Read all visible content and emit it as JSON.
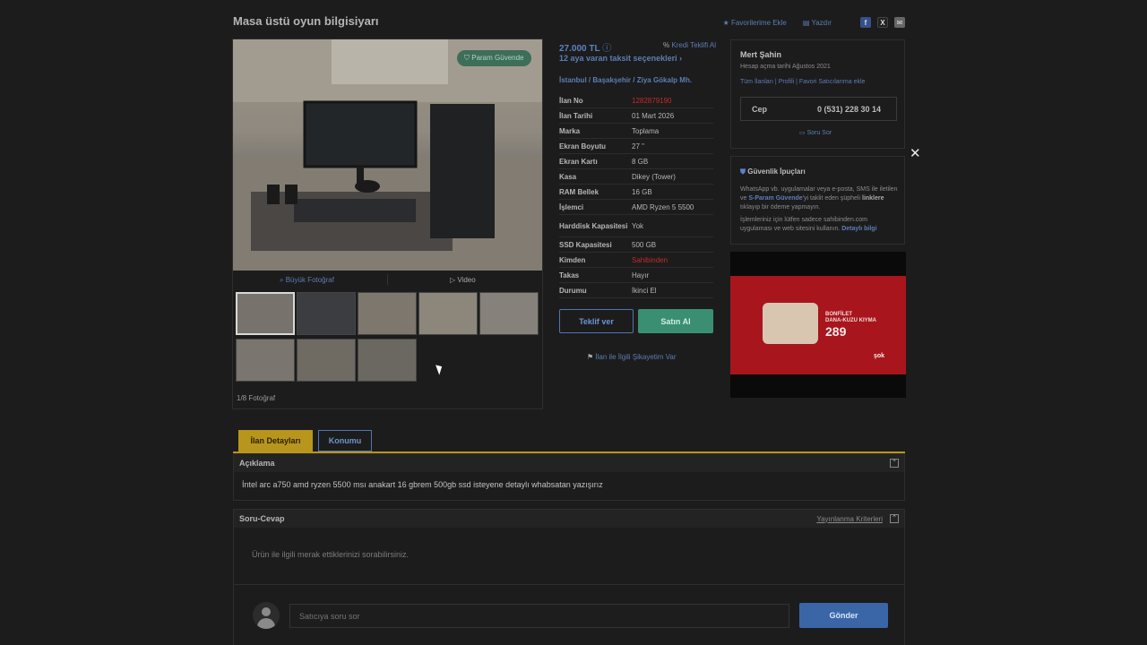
{
  "page": {
    "title": "Masa üstü oyun bilgisiyarı",
    "actions": {
      "favorite": "Favorilerime Ekle",
      "print": "Yazdır"
    },
    "social": {
      "facebook": "f",
      "x": "X",
      "mail": "✉"
    }
  },
  "gallery": {
    "badge": "Param Güvende",
    "big_photo": "Büyük Fotoğraf",
    "video": "Video",
    "photo_count": "1/8 Fotoğraf"
  },
  "listing": {
    "price": "27.000 TL",
    "credit": "Kredi Teklifi Al",
    "installment": "12 aya varan taksit seçenekleri",
    "location": [
      "İstanbul",
      "Başakşehir",
      "Ziya Gökalp Mh."
    ],
    "specs": [
      {
        "k": "İlan No",
        "v": "1282879190",
        "red": true
      },
      {
        "k": "İlan Tarihi",
        "v": "01 Mart 2026"
      },
      {
        "k": "Marka",
        "v": "Toplama"
      },
      {
        "k": "Ekran Boyutu",
        "v": "27 \""
      },
      {
        "k": "Ekran Kartı",
        "v": "8 GB"
      },
      {
        "k": "Kasa",
        "v": "Dikey (Tower)"
      },
      {
        "k": "RAM Bellek",
        "v": "16 GB"
      },
      {
        "k": "İşlemci",
        "v": "AMD Ryzen 5 5500"
      },
      {
        "k": "Harddisk Kapasitesi",
        "v": "Yok"
      },
      {
        "k": "SSD Kapasitesi",
        "v": "500 GB"
      },
      {
        "k": "Kimden",
        "v": "Sahibinden",
        "red": true
      },
      {
        "k": "Takas",
        "v": "Hayır"
      },
      {
        "k": "Durumu",
        "v": "İkinci El"
      }
    ],
    "offer_button": "Teklif ver",
    "buy_button": "Satın Al",
    "complaint": "İlan ile İlgili Şikayetim Var"
  },
  "seller": {
    "name": "Mert Şahin",
    "since": "Hesap açma tarihi Ağustos 2021",
    "links": [
      "Tüm İlanları",
      "Profili",
      "Favori Satıcılarıma ekle"
    ],
    "phone_label": "Cep",
    "phone": "0 (531) 228 30 14",
    "ask": "Soru Sor"
  },
  "security": {
    "title": "Güvenlik İpuçları",
    "p1_a": "WhatsApp vb. uygulamalar veya e-posta, SMS ile iletilen ve",
    "p1_link": "S-Param Güvende",
    "p1_b": "'yi taklit eden şüpheli",
    "p1_link2": "linklere",
    "p1_c": "tıklayıp bir ödeme yapmayın.",
    "p2": "İşlemleriniz için lütfen sadece sahibinden.com uygulaması ve web sitesini kullanın.",
    "p2_link": "Detaylı bilgi"
  },
  "ad": {
    "line1": "BONFİLET",
    "line2": "DANA-KUZU KIYMA",
    "price": "289",
    "brand": "şok"
  },
  "tabs": {
    "details": "İlan Detayları",
    "location": "Konumu"
  },
  "description": {
    "title": "Açıklama",
    "text": "İntel arc a750 amd ryzen 5500 msı anakart 16 gbrem 500gb ssd isteyene detaylı whabsatan yazışırız"
  },
  "qa": {
    "title": "Soru-Cevap",
    "criteria": "Yayınlanma Kriterleri",
    "empty": "Ürün ile ilgili merak ettiklerinizi sorabilirsiniz.",
    "placeholder": "Satıcıya soru sor",
    "send": "Gönder"
  },
  "colors": {
    "accent": "#5b82c2",
    "gold": "#b8951c",
    "green": "#3a8f73",
    "red": "#c52a2a"
  }
}
